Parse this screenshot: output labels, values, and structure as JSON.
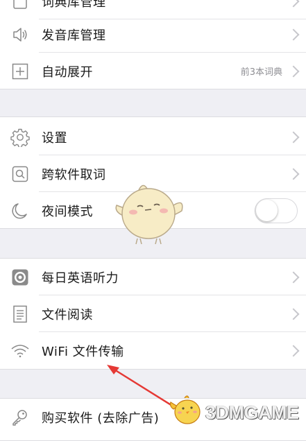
{
  "colors": {
    "background": "#efeff4",
    "cell": "#ffffff",
    "text": "#1a1a1a",
    "secondary": "#8e8e93",
    "arrow": "#e53935",
    "watermark_orange": "#f08a24"
  },
  "menu": {
    "group1": [
      {
        "label": "词典库管理",
        "icon": "book-icon"
      },
      {
        "label": "发音库管理",
        "icon": "speaker-icon"
      },
      {
        "label": "自动展开",
        "icon": "plus-box-icon",
        "value": "前3本词典"
      }
    ],
    "group2": [
      {
        "label": "设置",
        "icon": "gear-icon"
      },
      {
        "label": "跨软件取词",
        "icon": "magnifier-box-icon"
      },
      {
        "label": "夜间模式",
        "icon": "moon-icon",
        "toggle_on": false
      }
    ],
    "group3": [
      {
        "label": "每日英语听力",
        "icon": "record-icon"
      },
      {
        "label": "文件阅读",
        "icon": "document-icon"
      },
      {
        "label": "WiFi 文件传输",
        "icon": "wifi-icon"
      }
    ],
    "group4": [
      {
        "label": "购买软件 (去除广告)",
        "icon": "key-icon"
      }
    ]
  },
  "watermark": {
    "text": "3DMGAME"
  }
}
